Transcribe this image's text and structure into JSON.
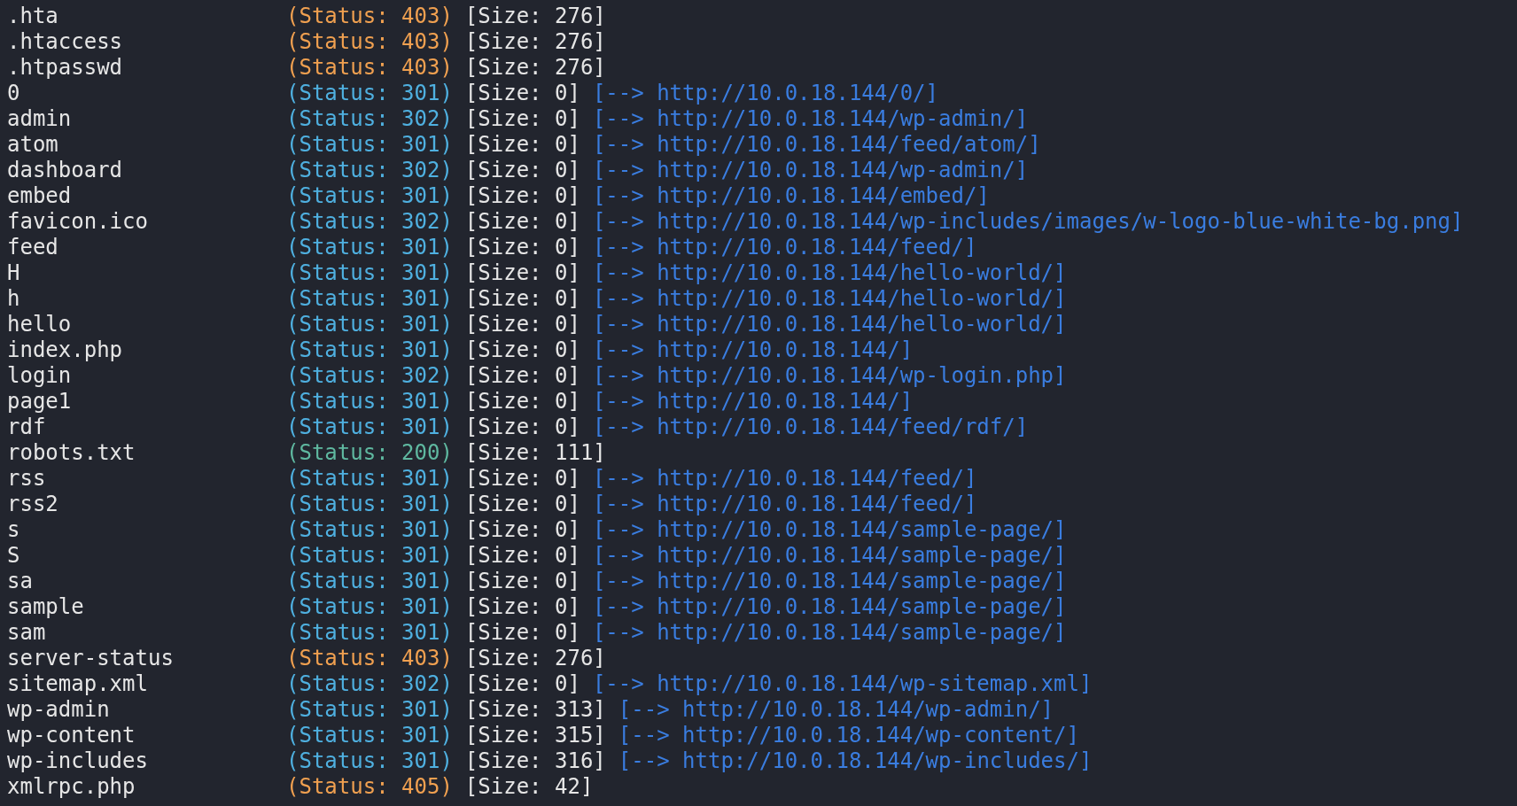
{
  "rows": [
    {
      "name": ".hta",
      "status": "(Status: 403)",
      "color": "#f0a050",
      "size": "[Size: 276]"
    },
    {
      "name": ".htaccess",
      "status": "(Status: 403)",
      "color": "#f0a050",
      "size": "[Size: 276]"
    },
    {
      "name": ".htpasswd",
      "status": "(Status: 403)",
      "color": "#f0a050",
      "size": "[Size: 276]"
    },
    {
      "name": "0",
      "status": "(Status: 301)",
      "color": "#4fb0e0",
      "size": "[Size: 0]",
      "redirect": "[--> http://10.0.18.144/0/]"
    },
    {
      "name": "admin",
      "status": "(Status: 302)",
      "color": "#4fb0e0",
      "size": "[Size: 0]",
      "redirect": "[--> http://10.0.18.144/wp-admin/]"
    },
    {
      "name": "atom",
      "status": "(Status: 301)",
      "color": "#4fb0e0",
      "size": "[Size: 0]",
      "redirect": "[--> http://10.0.18.144/feed/atom/]"
    },
    {
      "name": "dashboard",
      "status": "(Status: 302)",
      "color": "#4fb0e0",
      "size": "[Size: 0]",
      "redirect": "[--> http://10.0.18.144/wp-admin/]"
    },
    {
      "name": "embed",
      "status": "(Status: 301)",
      "color": "#4fb0e0",
      "size": "[Size: 0]",
      "redirect": "[--> http://10.0.18.144/embed/]"
    },
    {
      "name": "favicon.ico",
      "status": "(Status: 302)",
      "color": "#4fb0e0",
      "size": "[Size: 0]",
      "redirect": "[--> http://10.0.18.144/wp-includes/images/w-logo-blue-white-bg.png]"
    },
    {
      "name": "feed",
      "status": "(Status: 301)",
      "color": "#4fb0e0",
      "size": "[Size: 0]",
      "redirect": "[--> http://10.0.18.144/feed/]"
    },
    {
      "name": "H",
      "status": "(Status: 301)",
      "color": "#4fb0e0",
      "size": "[Size: 0]",
      "redirect": "[--> http://10.0.18.144/hello-world/]"
    },
    {
      "name": "h",
      "status": "(Status: 301)",
      "color": "#4fb0e0",
      "size": "[Size: 0]",
      "redirect": "[--> http://10.0.18.144/hello-world/]"
    },
    {
      "name": "hello",
      "status": "(Status: 301)",
      "color": "#4fb0e0",
      "size": "[Size: 0]",
      "redirect": "[--> http://10.0.18.144/hello-world/]"
    },
    {
      "name": "index.php",
      "status": "(Status: 301)",
      "color": "#4fb0e0",
      "size": "[Size: 0]",
      "redirect": "[--> http://10.0.18.144/]"
    },
    {
      "name": "login",
      "status": "(Status: 302)",
      "color": "#4fb0e0",
      "size": "[Size: 0]",
      "redirect": "[--> http://10.0.18.144/wp-login.php]"
    },
    {
      "name": "page1",
      "status": "(Status: 301)",
      "color": "#4fb0e0",
      "size": "[Size: 0]",
      "redirect": "[--> http://10.0.18.144/]"
    },
    {
      "name": "rdf",
      "status": "(Status: 301)",
      "color": "#4fb0e0",
      "size": "[Size: 0]",
      "redirect": "[--> http://10.0.18.144/feed/rdf/]"
    },
    {
      "name": "robots.txt",
      "status": "(Status: 200)",
      "color": "#5fb8a0",
      "size": "[Size: 111]"
    },
    {
      "name": "rss",
      "status": "(Status: 301)",
      "color": "#4fb0e0",
      "size": "[Size: 0]",
      "redirect": "[--> http://10.0.18.144/feed/]"
    },
    {
      "name": "rss2",
      "status": "(Status: 301)",
      "color": "#4fb0e0",
      "size": "[Size: 0]",
      "redirect": "[--> http://10.0.18.144/feed/]"
    },
    {
      "name": "s",
      "status": "(Status: 301)",
      "color": "#4fb0e0",
      "size": "[Size: 0]",
      "redirect": "[--> http://10.0.18.144/sample-page/]"
    },
    {
      "name": "S",
      "status": "(Status: 301)",
      "color": "#4fb0e0",
      "size": "[Size: 0]",
      "redirect": "[--> http://10.0.18.144/sample-page/]"
    },
    {
      "name": "sa",
      "status": "(Status: 301)",
      "color": "#4fb0e0",
      "size": "[Size: 0]",
      "redirect": "[--> http://10.0.18.144/sample-page/]"
    },
    {
      "name": "sample",
      "status": "(Status: 301)",
      "color": "#4fb0e0",
      "size": "[Size: 0]",
      "redirect": "[--> http://10.0.18.144/sample-page/]"
    },
    {
      "name": "sam",
      "status": "(Status: 301)",
      "color": "#4fb0e0",
      "size": "[Size: 0]",
      "redirect": "[--> http://10.0.18.144/sample-page/]"
    },
    {
      "name": "server-status",
      "status": "(Status: 403)",
      "color": "#f0a050",
      "size": "[Size: 276]"
    },
    {
      "name": "sitemap.xml",
      "status": "(Status: 302)",
      "color": "#4fb0e0",
      "size": "[Size: 0]",
      "redirect": "[--> http://10.0.18.144/wp-sitemap.xml]"
    },
    {
      "name": "wp-admin",
      "status": "(Status: 301)",
      "color": "#4fb0e0",
      "size": "[Size: 313]",
      "redirect": "[--> http://10.0.18.144/wp-admin/]"
    },
    {
      "name": "wp-content",
      "status": "(Status: 301)",
      "color": "#4fb0e0",
      "size": "[Size: 315]",
      "redirect": "[--> http://10.0.18.144/wp-content/]"
    },
    {
      "name": "wp-includes",
      "status": "(Status: 301)",
      "color": "#4fb0e0",
      "size": "[Size: 316]",
      "redirect": "[--> http://10.0.18.144/wp-includes/]"
    },
    {
      "name": "xmlrpc.php",
      "status": "(Status: 405)",
      "color": "#f0a050",
      "size": "[Size: 42]"
    }
  ]
}
